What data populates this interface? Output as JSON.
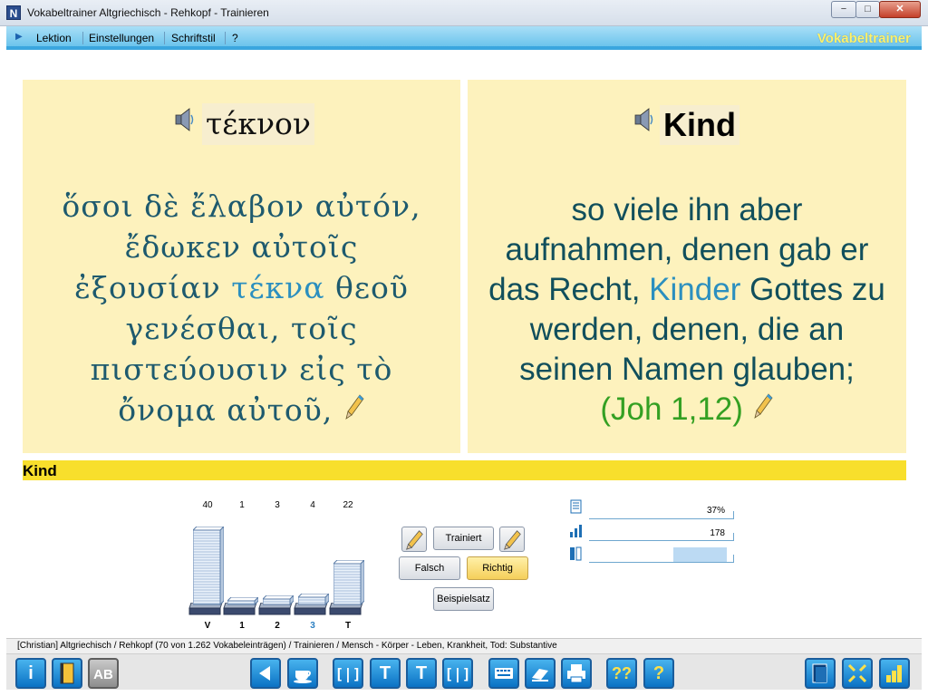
{
  "window": {
    "title": "Vokabeltrainer Altgriechisch - Rehkopf - Trainieren",
    "app_icon": "N",
    "minimize": "−",
    "maximize": "□",
    "close": "✕"
  },
  "menu": {
    "items": [
      "Lektion",
      "Einstellungen",
      "Schriftstil",
      "?"
    ],
    "brand": "Vokabeltrainer"
  },
  "card_left": {
    "word": "τέκνον",
    "sentence_pre": "ὅσοι δὲ ἔλαβον αὐτόν, ἔδωκεν αὐτοῖς ἐξουσίαν",
    "sentence_hl": "τέκνα",
    "sentence_post": "θεοῦ γενέσθαι, τοῖς πιστεύουσιν εἰς τὸ ὄνομα αὐτοῦ,"
  },
  "card_right": {
    "word": "Kind",
    "sentence_pre": "so viele ihn aber aufnahmen, denen gab er das Recht,",
    "sentence_hl": "Kinder",
    "sentence_post": "Gottes zu werden, denen, die an seinen Namen glauben;",
    "reference": "(Joh 1,12)"
  },
  "answer_bar": {
    "text": "Kind"
  },
  "chart_data": {
    "type": "bar",
    "categories": [
      "V",
      "1",
      "2",
      "3",
      "T"
    ],
    "values": [
      40,
      1,
      3,
      4,
      22
    ],
    "highlight_category": "3"
  },
  "buttons": {
    "trainiert": "Trainiert",
    "falsch": "Falsch",
    "richtig": "Richtig",
    "beispielsatz": "Beispielsatz"
  },
  "stats": {
    "percent": "37%",
    "count": "178",
    "progress": 0.37
  },
  "status": {
    "text": "[Christian]  Altgriechisch / Rehkopf  (70 von 1.262 Vokabeleinträgen) / Trainieren / Mensch - Körper - Leben, Krankheit, Tod: Substantive"
  },
  "toolbar": {
    "info": "i",
    "ab": "AB",
    "t1": "T",
    "t2": "T",
    "help1": "??",
    "help2": "?"
  },
  "colors": {
    "card_bg": "#fdf2bd",
    "greek_text": "#1e5a6e",
    "highlight": "#2b8fbf",
    "reference": "#34a023",
    "answer_bar": "#f8df2c",
    "menu_bar": "#6cc4ec",
    "brand_text": "#fff26a"
  }
}
